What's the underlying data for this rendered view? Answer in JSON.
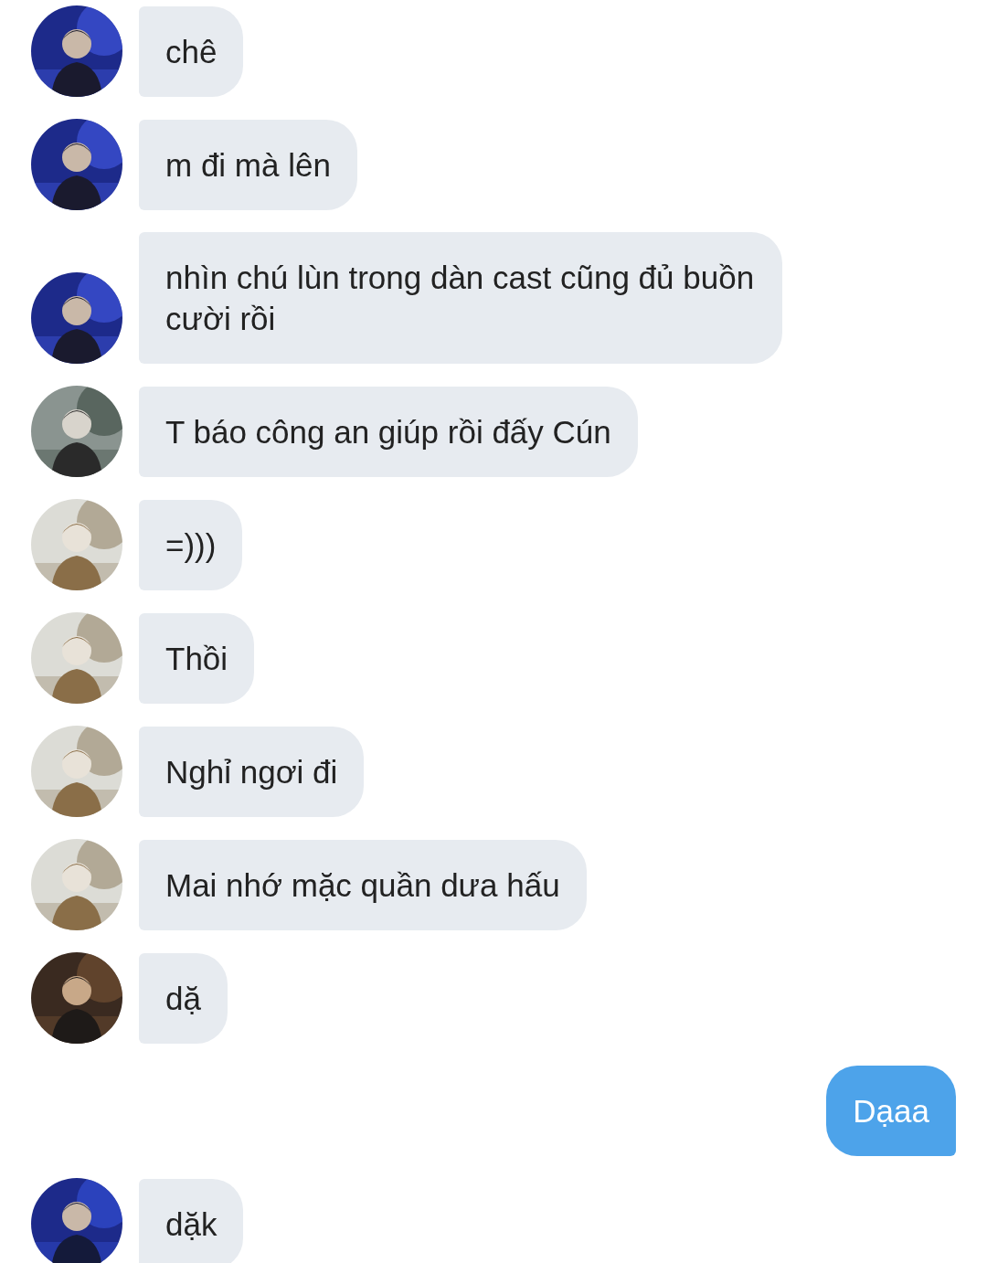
{
  "messages": [
    {
      "kind": "incoming",
      "text": "chê"
    },
    {
      "kind": "incoming",
      "text": "m đi mà lên"
    },
    {
      "kind": "incoming",
      "text": "nhìn chú lùn trong dàn cast cũng đủ buồn cười rồi"
    },
    {
      "kind": "incoming",
      "text": "T báo công an giúp rồi đấy Cún"
    },
    {
      "kind": "incoming",
      "text": "=)))"
    },
    {
      "kind": "incoming",
      "text": "Thồi"
    },
    {
      "kind": "incoming",
      "text": "Nghỉ ngơi đi"
    },
    {
      "kind": "incoming",
      "text": "Mai nhớ mặc quần dưa hấu"
    },
    {
      "kind": "incoming",
      "text": "dặ"
    },
    {
      "kind": "outgoing",
      "text": "Dạaa"
    },
    {
      "kind": "incoming",
      "text": "dặk"
    }
  ]
}
